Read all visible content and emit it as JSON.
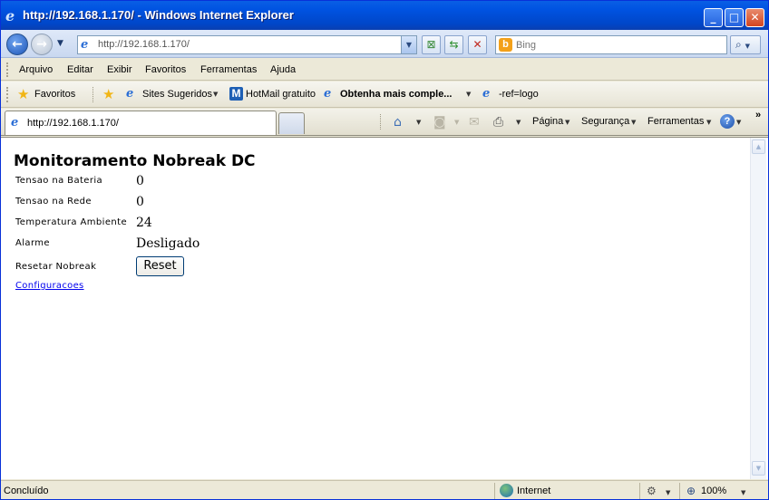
{
  "window": {
    "title": "http://192.168.1.170/ - Windows Internet Explorer",
    "minimize_glyph": "_",
    "maximize_glyph": "□",
    "close_glyph": "✕"
  },
  "address_bar": {
    "url": "http://192.168.1.170/",
    "search_placeholder": "Bing"
  },
  "menu": {
    "items": [
      "Arquivo",
      "Editar",
      "Exibir",
      "Favoritos",
      "Ferramentas",
      "Ajuda"
    ]
  },
  "favorites_bar": {
    "favorites_label": "Favoritos",
    "items": [
      "Sites Sugeridos",
      "HotMail gratuito",
      "Obtenha mais comple...",
      "-ref=logo"
    ]
  },
  "tabs": {
    "active_label": "http://192.168.1.170/"
  },
  "command_bar": {
    "page_label": "Página",
    "safety_label": "Segurança",
    "tools_label": "Ferramentas",
    "overflow_label": "»"
  },
  "page": {
    "heading": "Monitoramento Nobreak DC",
    "rows": [
      {
        "label": "Tensao na Bateria",
        "value": "0"
      },
      {
        "label": "Tensao na Rede",
        "value": "0"
      },
      {
        "label": "Temperatura Ambiente",
        "value": "24"
      },
      {
        "label": "Alarme",
        "value": "Desligado"
      },
      {
        "label": "Resetar Nobreak",
        "value": ""
      }
    ],
    "reset_button": "Reset",
    "config_link": "Configuracoes"
  },
  "status_bar": {
    "status": "Concluído",
    "zone": "Internet",
    "zoom": "100%"
  },
  "colors": {
    "titlebar": "#0053e1",
    "link": "#0000ee",
    "bing": "#f3a019"
  }
}
